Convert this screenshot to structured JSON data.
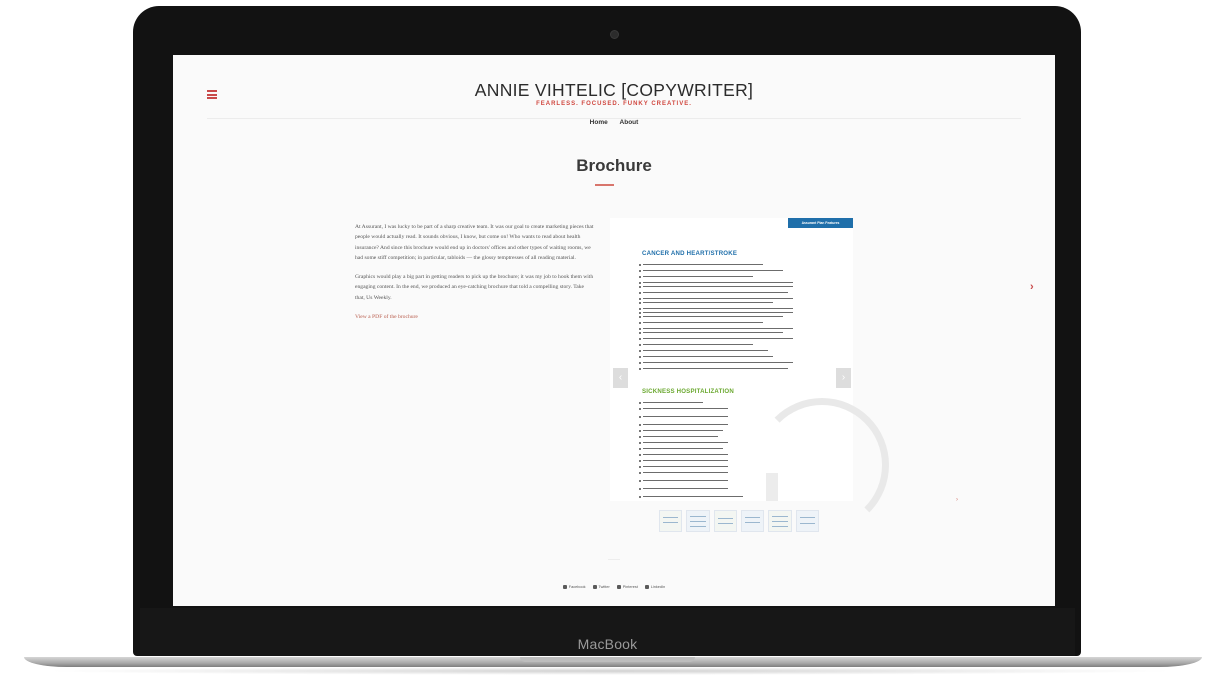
{
  "device": {
    "brand": "MacBook"
  },
  "site": {
    "title": "ANNIE VIHTELIC [COPYWRITER]",
    "tagline": "FEARLESS. FOCUSED. FUNKY CREATIVE.",
    "nav": [
      "Home",
      "About"
    ],
    "accent_color": "#d0473f"
  },
  "page": {
    "title": "Brochure",
    "paragraphs": [
      "At Assurant, I was lucky to be part of a sharp creative team. It was our goal to create marketing pieces that people would actually read. It sounds obvious, I know, but come on! Who wants to read about health insurance? And since this brochure would end up in doctors' offices and other types of waiting rooms, we had some stiff competition; in particular, tabloids — the glossy temptresses of all reading material.",
      "Graphics would play a big part in getting readers to pick up the brochure; it was my job to hook them with engaging content. In the end, we produced an eye-catching brochure that told a compelling story. Take that, Us Weekly."
    ],
    "pdf_link": "View a PDF of the brochure"
  },
  "slide": {
    "tag": "Assurant Plan Features",
    "section1": "CANCER AND HEART/STROKE",
    "section2": "SICKNESS HOSPITALIZATION"
  },
  "share": [
    "Facebook",
    "Twitter",
    "Pinterest",
    "LinkedIn"
  ]
}
